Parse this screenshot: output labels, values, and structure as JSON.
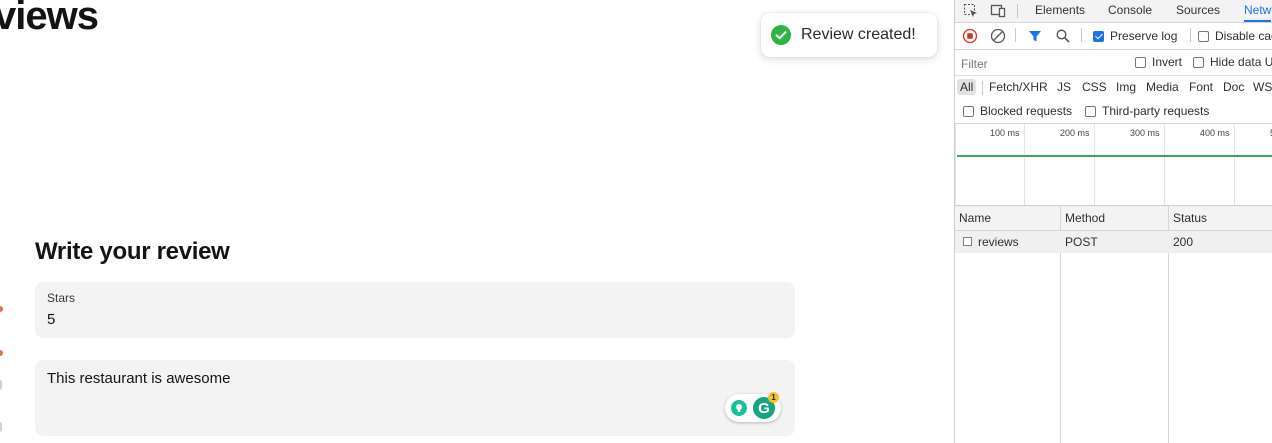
{
  "page": {
    "heading": "views",
    "toast": {
      "message": "Review created!",
      "icon": "check-circle-icon",
      "color": "#2fb344"
    },
    "form": {
      "title": "Write your review",
      "stars_label": "Stars",
      "stars_value": "5",
      "review_text": "This restaurant is awesome",
      "grammarly_count": "1",
      "grammarly_letter": "G"
    }
  },
  "devtools": {
    "tabs": [
      "Elements",
      "Console",
      "Sources",
      "Netw"
    ],
    "active_tab": "Netw",
    "toolbar": {
      "preserve_log_label": "Preserve log",
      "preserve_log_checked": true,
      "disable_cache_label": "Disable cac",
      "disable_cache_checked": false
    },
    "filter": {
      "placeholder": "Filter",
      "invert_label": "Invert",
      "hide_data_label": "Hide data U"
    },
    "types": [
      "All",
      "Fetch/XHR",
      "JS",
      "CSS",
      "Img",
      "Media",
      "Font",
      "Doc",
      "WS"
    ],
    "active_type": "All",
    "blocked_label": "Blocked requests",
    "third_party_label": "Third-party requests",
    "timeline_ticks": [
      "100 ms",
      "200 ms",
      "300 ms",
      "400 ms",
      "5"
    ],
    "accent_color": "#1a73e8",
    "table": {
      "columns": [
        "Name",
        "Method",
        "Status"
      ],
      "rows": [
        {
          "name": "reviews",
          "method": "POST",
          "status": "200"
        }
      ]
    }
  }
}
